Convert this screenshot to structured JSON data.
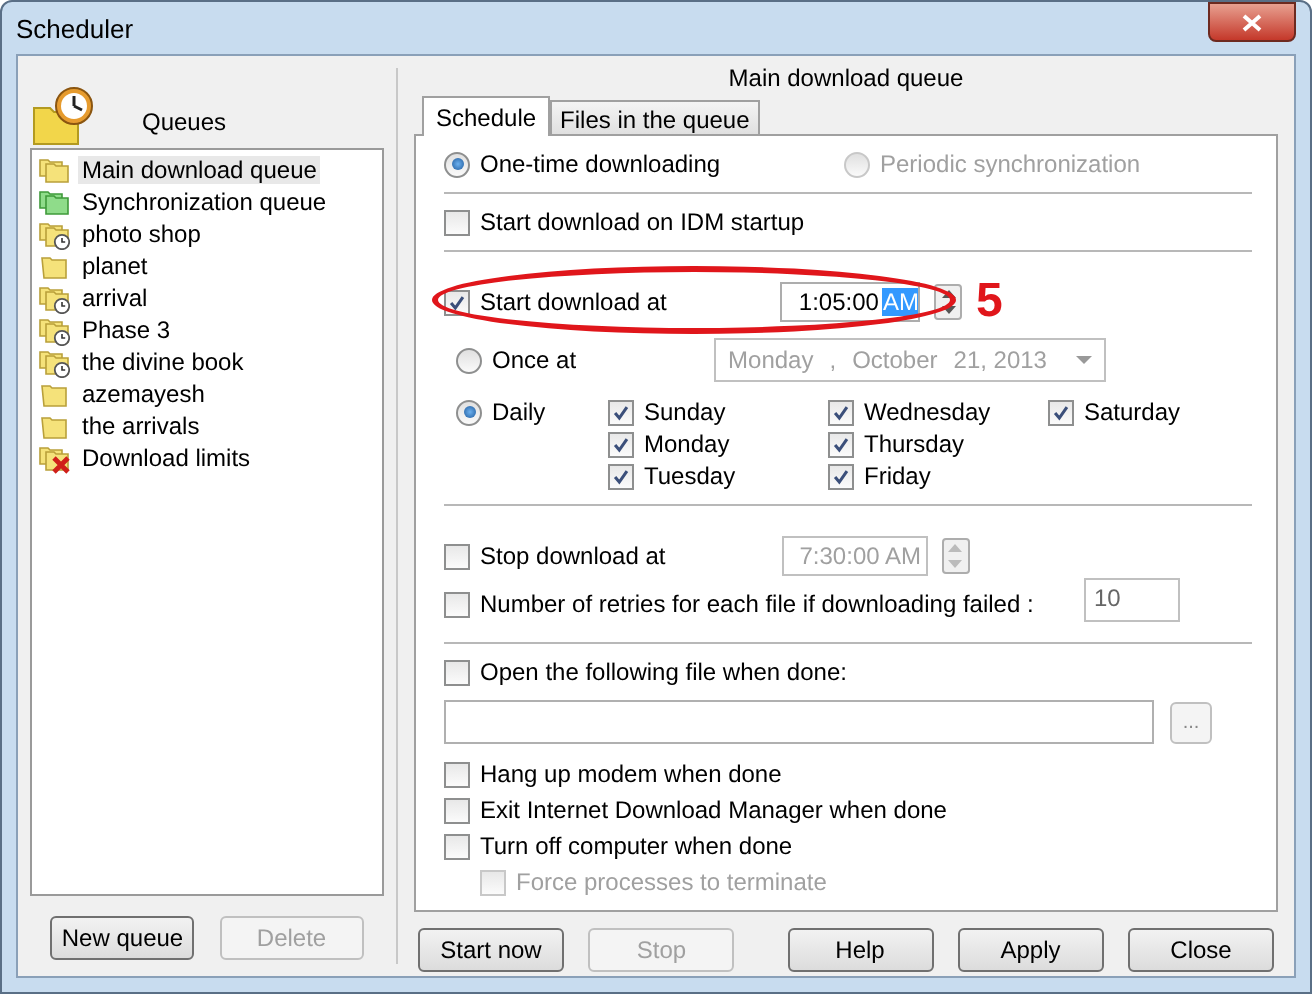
{
  "window": {
    "title": "Scheduler"
  },
  "queues": {
    "header": "Queues",
    "items": [
      {
        "label": "Main download queue",
        "kind": "queue",
        "selected": true
      },
      {
        "label": "Synchronization queue",
        "kind": "sync",
        "selected": false
      },
      {
        "label": "photo shop",
        "kind": "scheduled",
        "selected": false
      },
      {
        "label": "planet",
        "kind": "folder",
        "selected": false
      },
      {
        "label": "arrival",
        "kind": "scheduled",
        "selected": false
      },
      {
        "label": "Phase 3",
        "kind": "scheduled",
        "selected": false
      },
      {
        "label": "the divine book",
        "kind": "scheduled",
        "selected": false
      },
      {
        "label": "azemayesh",
        "kind": "folder",
        "selected": false
      },
      {
        "label": "the arrivals",
        "kind": "folder",
        "selected": false
      },
      {
        "label": "Download limits",
        "kind": "limits",
        "selected": false
      }
    ]
  },
  "left_buttons": [
    {
      "label": "New queue",
      "disabled": false
    },
    {
      "label": "Delete",
      "disabled": true
    }
  ],
  "panel_title": "Main download queue",
  "tabs": [
    {
      "label": "Schedule",
      "selected": true
    },
    {
      "label": "Files in the queue",
      "selected": false
    }
  ],
  "modes": [
    {
      "label": "One-time downloading",
      "selected": true,
      "disabled": false
    },
    {
      "label": "Periodic synchronization",
      "selected": false,
      "disabled": true
    }
  ],
  "start_on_startup": {
    "label": "Start download on IDM startup",
    "checked": false
  },
  "start_at": {
    "label": "Start download at",
    "checked": true,
    "time": [
      {
        "text": "1:05:00",
        "selected": false
      },
      {
        "text": "AM",
        "selected": true
      }
    ]
  },
  "annotation": "5",
  "once_at": {
    "label": "Once at",
    "selected": false,
    "date": [
      "Monday",
      ",",
      "October",
      "21, 2013"
    ]
  },
  "daily": {
    "label": "Daily",
    "selected": true,
    "days": [
      {
        "label": "Sunday",
        "checked": true
      },
      {
        "label": "Monday",
        "checked": true
      },
      {
        "label": "Tuesday",
        "checked": true
      },
      {
        "label": "Wednesday",
        "checked": true
      },
      {
        "label": "Thursday",
        "checked": true
      },
      {
        "label": "Friday",
        "checked": true
      },
      {
        "label": "Saturday",
        "checked": true
      }
    ]
  },
  "stop_at": {
    "label": "Stop download at",
    "checked": false,
    "time": "7:30:00 AM"
  },
  "retries": {
    "label": "Number of retries for each file if downloading failed :",
    "checked": false,
    "value": "10"
  },
  "open_file": {
    "label": "Open the following file when done:",
    "checked": false,
    "browse": "..."
  },
  "options": [
    {
      "label": "Hang up modem when done",
      "checked": false,
      "disabled": false
    },
    {
      "label": "Exit Internet Download Manager when done",
      "checked": false,
      "disabled": false
    },
    {
      "label": "Turn off computer when done",
      "checked": false,
      "disabled": false,
      "children": [
        {
          "label": "Force processes to terminate",
          "checked": false,
          "disabled": true
        }
      ]
    }
  ],
  "bottom_buttons": [
    {
      "label": "Start now",
      "disabled": false
    },
    {
      "label": "Stop",
      "disabled": true
    },
    {
      "label": "Help",
      "disabled": false
    },
    {
      "label": "Apply",
      "disabled": false
    },
    {
      "label": "Close",
      "disabled": false
    }
  ]
}
